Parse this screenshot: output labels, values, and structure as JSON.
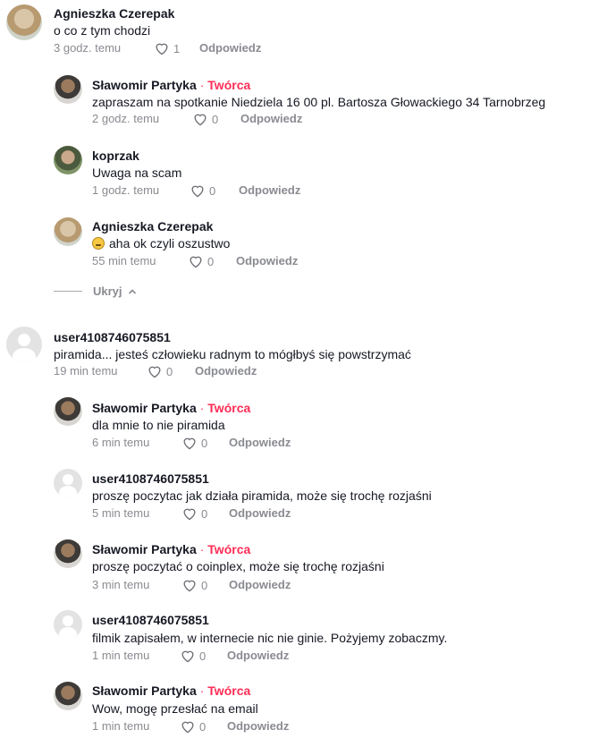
{
  "reply_label": "Odpowiedz",
  "hide_label": "Ukryj",
  "creator_sep": "·",
  "creator_label": "Twórca",
  "accent_color": "#fe2c55",
  "comments": [
    {
      "name": "Agnieszka Czerepak",
      "text": "o co z tym chodzi",
      "time": "3 godz. temu",
      "likes": "1",
      "avatar": "photo"
    },
    {
      "name": "Sławomir Partyka",
      "creator": true,
      "text": "zapraszam na spotkanie Niedziela 16 00 pl. Bartosza Głowackiego 34 Tarnobrzeg",
      "time": "2 godz. temu",
      "likes": "0",
      "avatar": "photo"
    },
    {
      "name": "koprzak",
      "text": "Uwaga na scam",
      "time": "1 godz. temu",
      "likes": "0",
      "avatar": "photo"
    },
    {
      "name": "Agnieszka Czerepak",
      "text": "aha ok czyli oszustwo",
      "emoji": "grinning-face",
      "time": "55 min temu",
      "likes": "0",
      "avatar": "photo"
    },
    {
      "name": "user4108746075851",
      "text": "piramida... jesteś człowieku radnym to mógłbyś się powstrzymać",
      "time": "19 min temu",
      "likes": "0",
      "avatar": "default"
    },
    {
      "name": "Sławomir Partyka",
      "creator": true,
      "text": "dla mnie to nie piramida",
      "time": "6 min temu",
      "likes": "0",
      "avatar": "photo"
    },
    {
      "name": "user4108746075851",
      "text": "proszę poczytac jak działa piramida, może się trochę rozjaśni",
      "time": "5 min temu",
      "likes": "0",
      "avatar": "default"
    },
    {
      "name": "Sławomir Partyka",
      "creator": true,
      "text": "proszę poczytać o coinplex, może się trochę rozjaśni",
      "time": "3 min temu",
      "likes": "0",
      "avatar": "photo"
    },
    {
      "name": "user4108746075851",
      "text": "filmik zapisałem, w internecie nic nie ginie. Pożyjemy zobaczmy.",
      "time": "1 min temu",
      "likes": "0",
      "avatar": "default"
    },
    {
      "name": "Sławomir Partyka",
      "creator": true,
      "text": "Wow, mogę przesłać na email",
      "time": "1 min temu",
      "likes": "0",
      "avatar": "photo"
    }
  ]
}
